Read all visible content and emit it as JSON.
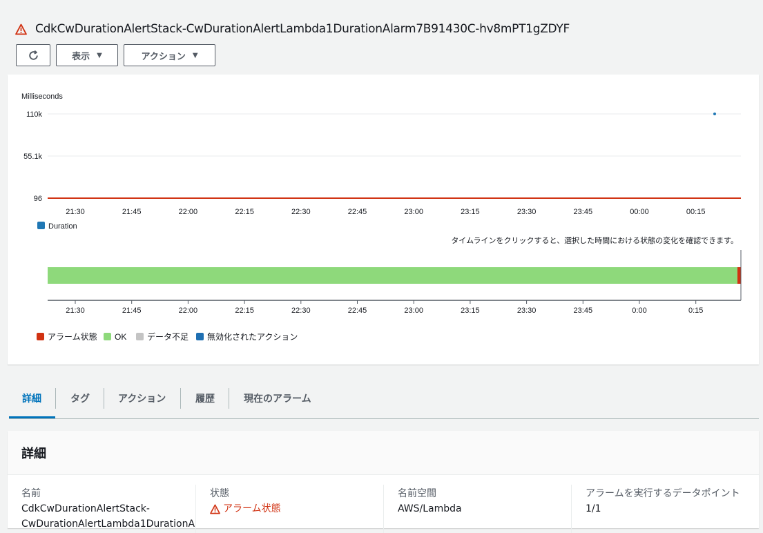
{
  "header": {
    "title": "CdkCwDurationAlertStack-CwDurationAlertLambda1DurationAlarm7B91430C-hv8mPT1gZDYF"
  },
  "toolbar": {
    "refresh_icon": "refresh-icon",
    "view_label": "表示",
    "actions_label": "アクション"
  },
  "chart_data": {
    "type": "line",
    "ylabel": "Milliseconds",
    "yticks": [
      "110k",
      "55.1k",
      "96"
    ],
    "xticks": [
      "21:30",
      "21:45",
      "22:00",
      "22:15",
      "22:30",
      "22:45",
      "23:00",
      "23:15",
      "23:30",
      "23:45",
      "00:00",
      "00:15"
    ],
    "series": [
      {
        "name": "Duration",
        "x": [
          "00:25"
        ],
        "values": [
          110000
        ],
        "color": "#1f77b4"
      }
    ],
    "threshold": {
      "value": 96,
      "color": "#d13212"
    },
    "legend_position": "bottom-left"
  },
  "timeline": {
    "hint": "タイムラインをクリックすると、選択した時間における状態の変化を確認できます。",
    "xticks": [
      "21:30",
      "21:45",
      "22:00",
      "22:15",
      "22:30",
      "22:45",
      "23:00",
      "23:15",
      "23:30",
      "23:45",
      "0:00",
      "0:15"
    ],
    "ok_fraction": 0.995,
    "alarm_fraction": 0.005,
    "legend": [
      {
        "label": "アラーム状態",
        "color": "#d13212"
      },
      {
        "label": "OK",
        "color": "#8ed97b"
      },
      {
        "label": "データ不足",
        "color": "#c4c4c4"
      },
      {
        "label": "無効化されたアクション",
        "color": "#1f6fb2"
      }
    ]
  },
  "tabs": [
    {
      "label": "詳細",
      "active": true
    },
    {
      "label": "タグ",
      "active": false
    },
    {
      "label": "アクション",
      "active": false
    },
    {
      "label": "履歴",
      "active": false
    },
    {
      "label": "現在のアラーム",
      "active": false
    }
  ],
  "details": {
    "heading": "詳細",
    "name_label": "名前",
    "name_value_line1": "CdkCwDurationAlertStack-",
    "name_value_line2": "CwDurationAlertLambda1DurationA",
    "state_label": "状態",
    "state_value": "アラーム状態",
    "namespace_label": "名前空間",
    "namespace_value": "AWS/Lambda",
    "datapoints_label": "アラームを実行するデータポイント",
    "datapoints_value": "1/1"
  },
  "colors": {
    "accent": "#0073bb",
    "alarm": "#d13212",
    "ok": "#8ed97b"
  }
}
